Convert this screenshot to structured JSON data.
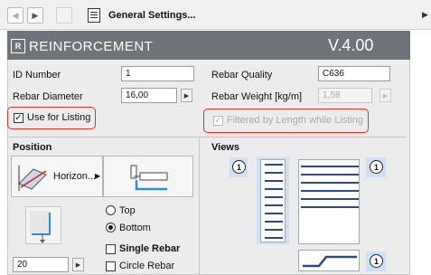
{
  "toolbar": {
    "title": "General Settings..."
  },
  "header": {
    "logo": "R",
    "title": "REINFORCEMENT",
    "version": "V.4.00",
    "bg_color": "#6f737a"
  },
  "fields": {
    "id_number_label": "ID Number",
    "id_number_value": "1",
    "rebar_quality_label": "Rebar Quality",
    "rebar_quality_value": "C636",
    "rebar_diameter_label": "Rebar Diameter",
    "rebar_diameter_value": "16,00",
    "rebar_weight_label": "Rebar Weight [kg/m]",
    "rebar_weight_value": "1,58"
  },
  "options": {
    "use_for_listing": "Use for Listing",
    "filtered_by_length": "Filtered by Length while Listing"
  },
  "position": {
    "heading": "Position",
    "orientation_label": "Horizon...",
    "radio_top": "Top",
    "radio_bottom": "Bottom",
    "single_rebar": "Single Rebar",
    "circle_rebar": "Circle Rebar",
    "value": "20"
  },
  "views": {
    "heading": "Views",
    "badge_left": "1",
    "badge_right": "1",
    "badge_bottom": "1"
  },
  "highlight_color": "#e0302a"
}
